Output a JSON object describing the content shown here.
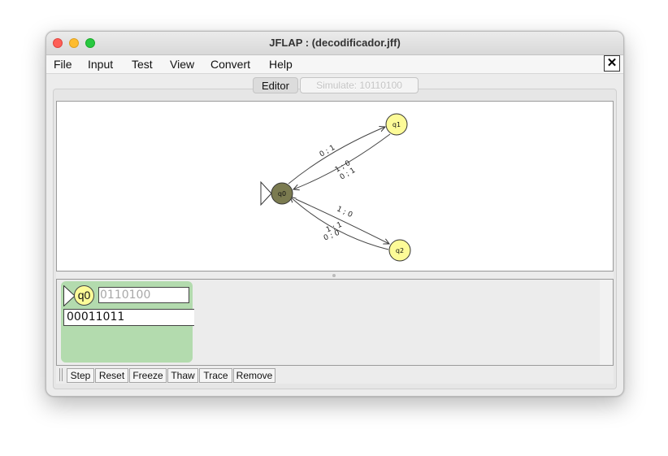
{
  "window": {
    "title": "JFLAP : (decodificador.jff)"
  },
  "menubar": {
    "items": [
      "File",
      "Input",
      "Test",
      "View",
      "Convert",
      "Help"
    ],
    "close_glyph": "✕"
  },
  "tabs": {
    "editor_label": "Editor",
    "simulate_label": "Simulate: 10110100"
  },
  "automaton": {
    "states": [
      {
        "id": "q0",
        "label": "q0",
        "initial": true,
        "highlighted": true
      },
      {
        "id": "q1",
        "label": "q1",
        "initial": false,
        "highlighted": false
      },
      {
        "id": "q2",
        "label": "q2",
        "initial": false,
        "highlighted": false
      }
    ],
    "transitions": [
      {
        "from": "q0",
        "to": "q1",
        "labels": [
          "0 ; 1"
        ]
      },
      {
        "from": "q1",
        "to": "q0",
        "labels": [
          "1 ; 0",
          "0 ; 1"
        ]
      },
      {
        "from": "q0",
        "to": "q2",
        "labels": [
          "1 ; 0"
        ]
      },
      {
        "from": "q2",
        "to": "q0",
        "labels": [
          "1 ; 1",
          "0 ; 0"
        ]
      }
    ]
  },
  "simulation": {
    "configuration": {
      "state": "q0",
      "remaining_input": "0110100",
      "output": "00011011"
    },
    "buttons": [
      "Step",
      "Reset",
      "Freeze",
      "Thaw",
      "Trace",
      "Remove"
    ]
  },
  "colors": {
    "state_fill": "#fdfb98",
    "active_state_fill": "#7b7b50",
    "config_background": "#b3dbae"
  },
  "icons": {
    "close": "close-icon",
    "initial_arrow": "initial-state-triangle-icon",
    "grip": "toolbar-grip-icon"
  }
}
